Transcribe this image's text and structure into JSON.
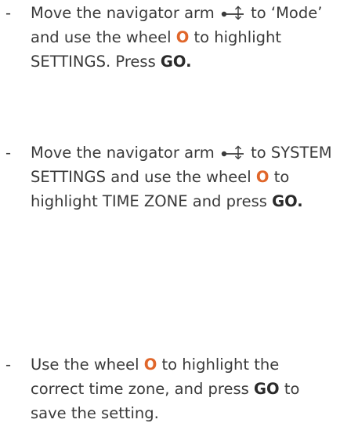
{
  "bullet": "-",
  "steps": [
    {
      "lines": [
        [
          {
            "t": "text",
            "v": "Move the navigator arm "
          },
          {
            "t": "icon",
            "name": "navigator-arm-icon"
          },
          {
            "t": "text",
            "v": " to ‘Mode’"
          }
        ],
        [
          {
            "t": "text",
            "v": "and use the wheel "
          },
          {
            "t": "hl",
            "v": "O"
          },
          {
            "t": "text",
            "v": " to highlight"
          }
        ],
        [
          {
            "t": "text",
            "v": "SETTINGS. Press "
          },
          {
            "t": "bold",
            "v": "GO."
          }
        ]
      ]
    },
    {
      "lines": [
        [
          {
            "t": "text",
            "v": "Move the navigator arm "
          },
          {
            "t": "icon",
            "name": "navigator-arm-icon"
          },
          {
            "t": "text",
            "v": " to SYSTEM"
          }
        ],
        [
          {
            "t": "text",
            "v": "SETTINGS and use the wheel "
          },
          {
            "t": "hl",
            "v": "O"
          },
          {
            "t": "text",
            "v": " to"
          }
        ],
        [
          {
            "t": "text",
            "v": "highlight TIME ZONE and press "
          },
          {
            "t": "bold",
            "v": "GO."
          }
        ]
      ]
    },
    {
      "lines": [
        [
          {
            "t": "text",
            "v": "Use the wheel "
          },
          {
            "t": "hl",
            "v": "O"
          },
          {
            "t": "text",
            "v": " to highlight the"
          }
        ],
        [
          {
            "t": "text",
            "v": "correct time zone, and press "
          },
          {
            "t": "bold",
            "v": "GO"
          },
          {
            "t": "text",
            "v": " to"
          }
        ],
        [
          {
            "t": "text",
            "v": "save the setting."
          }
        ]
      ]
    }
  ],
  "colors": {
    "text": "#3a3a3a",
    "wheel_highlight": "#e0662a"
  }
}
